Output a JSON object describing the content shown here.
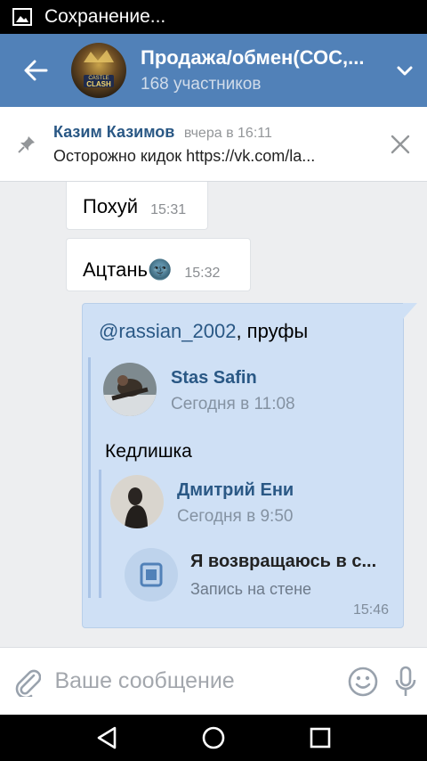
{
  "status_bar": {
    "text": "Сохранение...",
    "icon": "image-icon"
  },
  "header": {
    "title": "Продажа/обмен(СОС,...",
    "subtitle": "168 участников",
    "avatar_text": "CASTLE CLASH",
    "back_icon": "arrow-left-icon",
    "menu_icon": "chevron-down-icon"
  },
  "pinned": {
    "author": "Казим Казимов",
    "time": "вчера в 16:11",
    "text": "Осторожно кидок https://vk.com/la..."
  },
  "messages": [
    {
      "text": "Похуй",
      "time": "15:31"
    },
    {
      "text": "Ацтань",
      "emoji": "🌚",
      "time": "15:32"
    }
  ],
  "outgoing": {
    "mention": "@rassian_2002",
    "text": ", пруфы",
    "time": "15:46",
    "forward": {
      "name": "Stas Safin",
      "date": "Сегодня в 11:08",
      "text": "Кедлишка",
      "nested": {
        "name": "Дмитрий Ени",
        "date": "Сегодня в 9:50",
        "attachment_title": "Я возвращаюсь в с...",
        "attachment_sub": "Запись на стене"
      }
    }
  },
  "composer": {
    "placeholder": "Ваше сообщение"
  },
  "colors": {
    "accent": "#5181b8",
    "bubble_out": "#cfe0f5",
    "link": "#2a5885"
  }
}
